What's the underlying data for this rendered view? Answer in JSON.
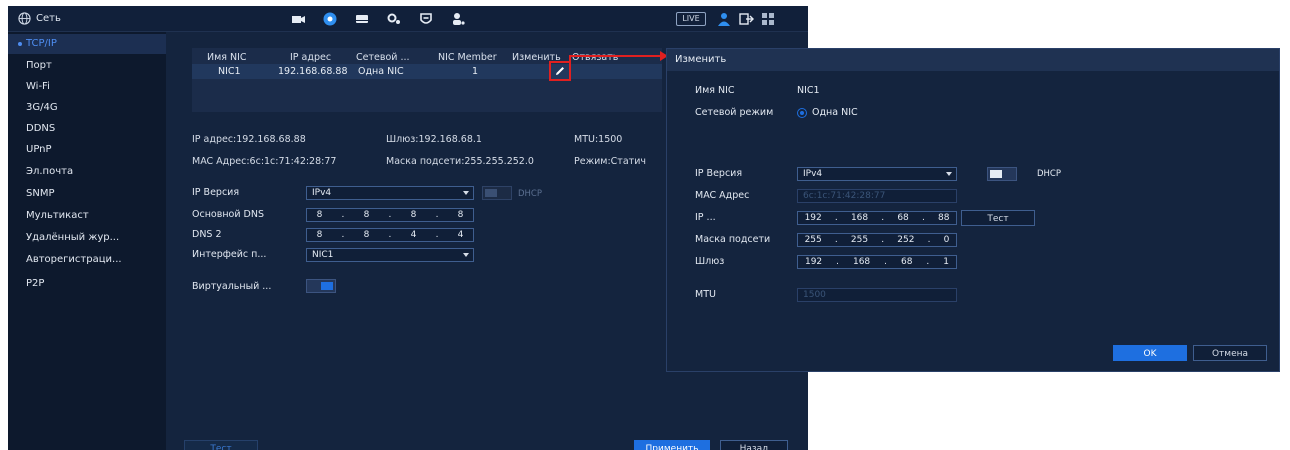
{
  "topbar": {
    "title": "Сеть",
    "live_label": "LIVE"
  },
  "sidebar": {
    "items": [
      {
        "label": "TCP/IP",
        "active": true
      },
      {
        "label": "Порт"
      },
      {
        "label": "Wi-Fi"
      },
      {
        "label": "3G/4G"
      },
      {
        "label": "DDNS"
      },
      {
        "label": "UPnP"
      },
      {
        "label": "Эл.почта"
      },
      {
        "label": "SNMP"
      },
      {
        "label": "Мультикаст"
      },
      {
        "label": "Удалённый жур..."
      },
      {
        "label": "Авторегистраци..."
      },
      {
        "label": "P2P"
      }
    ]
  },
  "nic_table": {
    "headers": [
      "Имя NIC",
      "IP адрес",
      "Сетевой ...",
      "NIC Member",
      "Изменить",
      "Отвязать"
    ],
    "rows": [
      {
        "name": "NIC1",
        "ip": "192.168.68.88",
        "mode": "Одна NIC",
        "member": "1"
      }
    ]
  },
  "info": {
    "ip": "IP адрес:192.168.68.88",
    "gateway": "Шлюз:192.168.68.1",
    "mtu": "MTU:1500",
    "mac": "MAC Адрес:6c:1c:71:42:28:77",
    "mask": "Маска подсети:255.255.252.0",
    "mode": "Режим:Статич"
  },
  "form": {
    "ip_version_label": "IP Версия",
    "ip_version_value": "IPv4",
    "dhcp_label": "DHCP",
    "dns1_label": "Основной DNS",
    "dns1": [
      "8",
      "8",
      "8",
      "8"
    ],
    "dns2_label": "DNS 2",
    "dns2": [
      "8",
      "8",
      "4",
      "4"
    ],
    "iface_label": "Интерфейс п...",
    "iface_value": "NIC1",
    "virtual_label": "Виртуальный ..."
  },
  "bottom": {
    "test": "Тест",
    "apply": "Применить",
    "back": "Назад"
  },
  "dialog": {
    "title": "Изменить",
    "nic_name_label": "Имя NIC",
    "nic_name_value": "NIC1",
    "net_mode_label": "Сетевой режим",
    "net_mode_value": "Одна NIC",
    "ip_version_label": "IP Версия",
    "ip_version_value": "IPv4",
    "dhcp_label": "DHCP",
    "mac_label": "MAC Адрес",
    "mac_value": "6c:1c:71:42:28:77",
    "ip_label": "IP ...",
    "ip": [
      "192",
      "168",
      "68",
      "88"
    ],
    "test_button": "Тест",
    "mask_label": "Маска подсети",
    "mask": [
      "255",
      "255",
      "252",
      "0"
    ],
    "gateway_label": "Шлюз",
    "gateway": [
      "192",
      "168",
      "68",
      "1"
    ],
    "mtu_label": "MTU",
    "mtu_value": "1500",
    "ok": "OK",
    "cancel": "Отмена"
  },
  "colors": {
    "accent": "#1e6fe0",
    "highlight": "#e02020"
  }
}
